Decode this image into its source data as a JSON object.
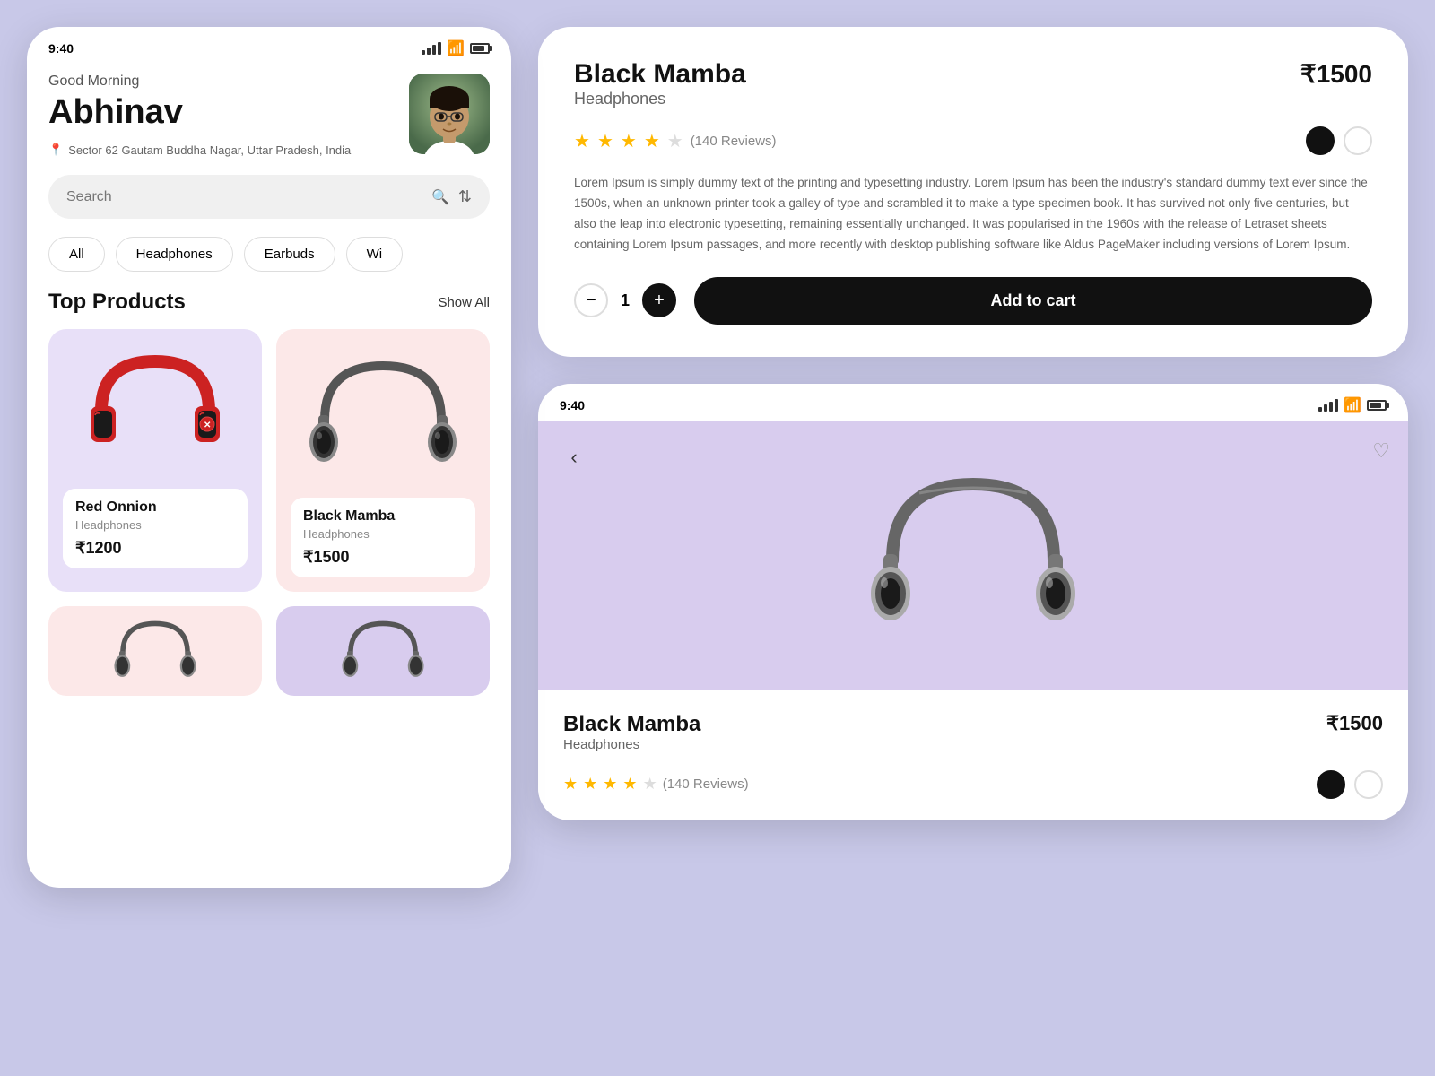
{
  "leftPhone": {
    "statusBar": {
      "time": "9:40"
    },
    "greeting": "Good Morning",
    "userName": "Abhinav",
    "location": "Sector 62 Gautam Buddha Nagar, Uttar Pradesh, India",
    "search": {
      "placeholder": "Search"
    },
    "categories": [
      {
        "label": "All",
        "active": false
      },
      {
        "label": "Headphones",
        "active": false
      },
      {
        "label": "Earbuds",
        "active": false
      },
      {
        "label": "Wi",
        "active": false
      }
    ],
    "topProducts": {
      "title": "Top Products",
      "showAll": "Show All"
    },
    "products": [
      {
        "name": "Red Onnion",
        "type": "Headphones",
        "price": "₹1200",
        "bg": "purple"
      },
      {
        "name": "Black Mamba",
        "type": "Headphones",
        "price": "₹1500",
        "bg": "pink"
      }
    ]
  },
  "detailCard": {
    "title": "Black Mamba",
    "subtitle": "Headphones",
    "price": "₹1500",
    "reviews": "(140 Reviews)",
    "stars": 4,
    "description": "Lorem Ipsum is simply dummy text of the printing and typesetting industry. Lorem Ipsum has been the industry's standard dummy text ever since the 1500s, when an unknown printer took a galley of type and scrambled it to make a type specimen book. It has survived not only five centuries, but also the leap into electronic typesetting, remaining essentially unchanged. It was popularised in the 1960s with the release of Letraset sheets containing Lorem Ipsum passages, and more recently with desktop publishing software like Aldus PageMaker including versions of Lorem Ipsum.",
    "quantity": 1,
    "addToCart": "Add to cart"
  },
  "bottomPhone": {
    "statusBar": {
      "time": "9:40"
    },
    "detail": {
      "title": "Black Mamba",
      "subtitle": "Headphones",
      "price": "₹1500",
      "reviews": "(140 Reviews)",
      "stars": 4
    }
  }
}
